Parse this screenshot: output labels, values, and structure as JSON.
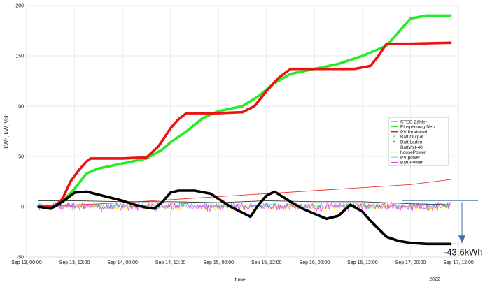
{
  "chart_data": {
    "type": "line",
    "xlabel": "time",
    "ylabel": "kWh, kW, Volt",
    "ylim": [
      -50,
      200
    ],
    "xlim": [
      "2022-09-13 00:00",
      "2022-09-17 12:00"
    ],
    "yticks": [
      -50,
      0,
      50,
      100,
      150,
      200
    ],
    "xticks": [
      {
        "at": "2022-09-13 00:00",
        "label": "Sep 13, 00:00"
      },
      {
        "at": "2022-09-13 12:00",
        "label": "Sep 13, 12:00"
      },
      {
        "at": "2022-09-14 00:00",
        "label": "Sep 14, 00:00"
      },
      {
        "at": "2022-09-14 12:00",
        "label": "Sep 14, 12:00"
      },
      {
        "at": "2022-09-15 00:00",
        "label": "Sep 15, 00:00"
      },
      {
        "at": "2022-09-15 12:00",
        "label": "Sep 15, 12:00"
      },
      {
        "at": "2022-09-16 00:00",
        "label": "Sep 16, 00:00"
      },
      {
        "at": "2022-09-16 12:00",
        "label": "Sep 16, 12:00"
      },
      {
        "at": "2022-09-17 00:00",
        "label": "Sep 17, 00:00"
      },
      {
        "at": "2022-09-17 12:00",
        "label": "Sep 17, 12:00"
      }
    ],
    "year_label": "2022",
    "grid": true,
    "legend_position": "right",
    "series": [
      {
        "name": "STEG Zähler",
        "color": "#f03030",
        "style": "thin",
        "x": [
          "2022-09-13 03:00",
          "2022-09-14 00:00",
          "2022-09-15 00:00",
          "2022-09-16 00:00",
          "2022-09-17 00:00",
          "2022-09-17 10:00"
        ],
        "y": [
          0,
          4,
          10,
          16,
          22,
          27
        ]
      },
      {
        "name": "Einspeisung Netz",
        "color": "#22ee22",
        "style": "thick",
        "x": [
          "2022-09-13 03:00",
          "2022-09-13 07:00",
          "2022-09-13 09:00",
          "2022-09-13 12:00",
          "2022-09-13 15:00",
          "2022-09-13 18:00",
          "2022-09-14 00:00",
          "2022-09-14 06:00",
          "2022-09-14 10:00",
          "2022-09-14 12:00",
          "2022-09-14 16:00",
          "2022-09-14 20:00",
          "2022-09-15 00:00",
          "2022-09-15 06:00",
          "2022-09-15 10:00",
          "2022-09-15 14:00",
          "2022-09-15 18:00",
          "2022-09-16 00:00",
          "2022-09-16 06:00",
          "2022-09-16 12:00",
          "2022-09-16 18:00",
          "2022-09-16 22:00",
          "2022-09-17 00:00",
          "2022-09-17 04:00",
          "2022-09-17 10:00"
        ],
        "y": [
          0,
          0,
          5,
          18,
          33,
          38,
          43,
          48,
          57,
          64,
          75,
          88,
          95,
          100,
          110,
          123,
          132,
          137,
          142,
          150,
          160,
          178,
          187,
          190,
          190
        ]
      },
      {
        "name": "PV Produced",
        "color": "#ee1111",
        "style": "thick",
        "x": [
          "2022-09-13 03:00",
          "2022-09-13 07:00",
          "2022-09-13 09:00",
          "2022-09-13 11:00",
          "2022-09-13 13:00",
          "2022-09-13 15:00",
          "2022-09-13 16:00",
          "2022-09-14 00:00",
          "2022-09-14 06:00",
          "2022-09-14 09:00",
          "2022-09-14 12:00",
          "2022-09-14 14:00",
          "2022-09-14 16:00",
          "2022-09-15 00:00",
          "2022-09-15 06:00",
          "2022-09-15 09:00",
          "2022-09-15 12:00",
          "2022-09-15 15:00",
          "2022-09-15 18:00",
          "2022-09-16 00:00",
          "2022-09-16 06:00",
          "2022-09-16 10:00",
          "2022-09-16 14:00",
          "2022-09-16 16:00",
          "2022-09-16 18:00",
          "2022-09-17 00:00",
          "2022-09-17 10:00"
        ],
        "y": [
          0,
          0,
          8,
          25,
          36,
          45,
          48,
          48,
          49,
          60,
          78,
          87,
          93,
          93,
          94,
          100,
          115,
          128,
          137,
          137,
          137,
          137,
          140,
          150,
          162,
          162,
          163
        ]
      },
      {
        "name": "Batt Output",
        "color": "#22ee22",
        "style": "marker"
      },
      {
        "name": "Batt Laden",
        "color": "#111111",
        "style": "marker"
      },
      {
        "name": "BattVolt-40",
        "color": "#333333",
        "style": "thin",
        "x": [
          "2022-09-13 03:00",
          "2022-09-13 12:00",
          "2022-09-14 00:00",
          "2022-09-14 12:00",
          "2022-09-15 00:00",
          "2022-09-15 12:00",
          "2022-09-16 00:00",
          "2022-09-16 12:00",
          "2022-09-17 00:00",
          "2022-09-17 10:00"
        ],
        "y": [
          6,
          6,
          5,
          5,
          4,
          6,
          5,
          5,
          3,
          2
        ]
      },
      {
        "name": "housePower",
        "color": "#f5e600",
        "style": "noisy",
        "x": [
          "2022-09-13 03:00",
          "2022-09-17 10:00"
        ],
        "y": [
          0,
          0
        ]
      },
      {
        "name": "PV power",
        "color": "#22dddd",
        "style": "noisy",
        "x": [
          "2022-09-13 03:00",
          "2022-09-17 10:00"
        ],
        "y": [
          1,
          1
        ]
      },
      {
        "name": "Batt Power",
        "color": "#ee22ee",
        "style": "noisy",
        "x": [
          "2022-09-13 03:00",
          "2022-09-17 10:00"
        ],
        "y": [
          0,
          0
        ]
      },
      {
        "name": "",
        "color": "#000000",
        "style": "thick",
        "x": [
          "2022-09-13 03:00",
          "2022-09-13 06:00",
          "2022-09-13 09:00",
          "2022-09-13 12:00",
          "2022-09-13 15:00",
          "2022-09-13 18:00",
          "2022-09-14 00:00",
          "2022-09-14 03:00",
          "2022-09-14 06:00",
          "2022-09-14 08:00",
          "2022-09-14 10:00",
          "2022-09-14 12:00",
          "2022-09-14 14:00",
          "2022-09-14 18:00",
          "2022-09-14 22:00",
          "2022-09-15 03:00",
          "2022-09-15 06:00",
          "2022-09-15 08:00",
          "2022-09-15 10:00",
          "2022-09-15 12:00",
          "2022-09-15 14:00",
          "2022-09-15 18:00",
          "2022-09-15 21:00",
          "2022-09-16 00:00",
          "2022-09-16 03:00",
          "2022-09-16 06:00",
          "2022-09-16 09:00",
          "2022-09-16 12:00",
          "2022-09-16 14:00",
          "2022-09-16 16:00",
          "2022-09-16 18:00",
          "2022-09-16 21:00",
          "2022-09-17 00:00",
          "2022-09-17 04:00",
          "2022-09-17 10:00"
        ],
        "y": [
          0,
          -2,
          5,
          14,
          15,
          12,
          6,
          2,
          -1,
          -2,
          5,
          14,
          16,
          16,
          13,
          0,
          -6,
          -10,
          2,
          11,
          15,
          5,
          -2,
          -7,
          -12,
          -9,
          2,
          -5,
          -14,
          -22,
          -30,
          -34,
          -36,
          -37,
          -37
        ]
      }
    ],
    "annotation": {
      "text": "-43.6kWh",
      "arrow_from": 6,
      "arrow_to": -37
    }
  }
}
